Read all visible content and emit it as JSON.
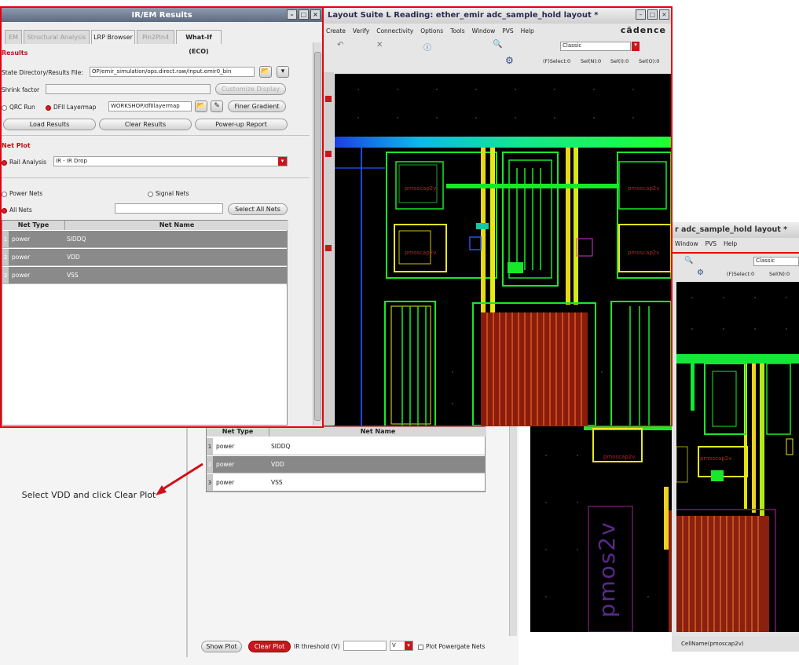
{
  "irem": {
    "title": "IR/EM Results",
    "tabs": [
      "EM",
      "Structural Analysis",
      "LRP Browser",
      "Pin2Pin4",
      "What-If (ECO)"
    ],
    "results_heading": "Results",
    "state_dir_label": "State Directory/Results File:",
    "state_dir_value": "OP/emir_simulation/ops.direct.raw/input.emir0_bin",
    "shrink_label": "Shrink factor",
    "customize_label": "Customize Display",
    "qrc_label": "QRC Run",
    "dfii_label": "DFII Layermap",
    "dfii_value": "WORKSHOP/dfIIlayermap",
    "finer_label": "Finer Gradient",
    "load_label": "Load Results",
    "clear_results_label": "Clear Results",
    "powerup_label": "Power-up Report",
    "netplot_heading": "Net Plot",
    "rail_label": "Rail Analysis",
    "rail_value": "IR - IR Drop",
    "power_nets_label": "Power Nets",
    "signal_nets_label": "Signal Nets",
    "all_nets_label": "All Nets",
    "select_all_label": "Select All Nets",
    "table_headers": [
      "Net Type",
      "Net Name"
    ],
    "rows": [
      {
        "n": "1",
        "type": "power",
        "name": "SIDDQ"
      },
      {
        "n": "2",
        "type": "power",
        "name": "VDD"
      },
      {
        "n": "3",
        "type": "power",
        "name": "VSS"
      }
    ]
  },
  "layout": {
    "title": "Layout Suite L Reading: ether_emir adc_sample_hold layout *",
    "menu": [
      "Create",
      "Verify",
      "Connectivity",
      "Options",
      "Tools",
      "Window",
      "PVS",
      "Help"
    ],
    "brand": "cādence",
    "classic": "Classic",
    "select_info": [
      "(F)Select:0",
      "Sel(N):0",
      "Sel(I):0",
      "Sel(O):0"
    ],
    "cell_labels": [
      "pmoscap2v",
      "pmoscap2v",
      "pmoscap2v",
      "pmoscap2v"
    ]
  },
  "layout2": {
    "title": "r adc_sample_hold layout *",
    "menu": [
      "Window",
      "PVS",
      "Help"
    ],
    "classic": "Classic",
    "select_info": [
      "(F)Select:0",
      "Sel(N):0"
    ],
    "cell_label": "pmoscap2v",
    "big_label": "pmos2v",
    "status": "CellName(pmoscap2v)"
  },
  "bottom": {
    "table_headers": [
      "Net Type",
      "Net Name"
    ],
    "rows": [
      {
        "n": "1",
        "type": "power",
        "name": "SIDDQ"
      },
      {
        "n": "2",
        "type": "power",
        "name": "VDD"
      },
      {
        "n": "3",
        "type": "power",
        "name": "VSS"
      }
    ],
    "show_plot": "Show Plot",
    "clear_plot": "Clear Plot",
    "ir_threshold": "IR threshold (V)",
    "unit": "V",
    "powergate": "Plot Powergate Nets"
  },
  "annotation": "Select VDD and click Clear Plot",
  "colors": {
    "accent": "#c0101a",
    "highlight_border": "#e8000e",
    "title_bar": "#6a7890",
    "layout_bg": "#000000"
  }
}
